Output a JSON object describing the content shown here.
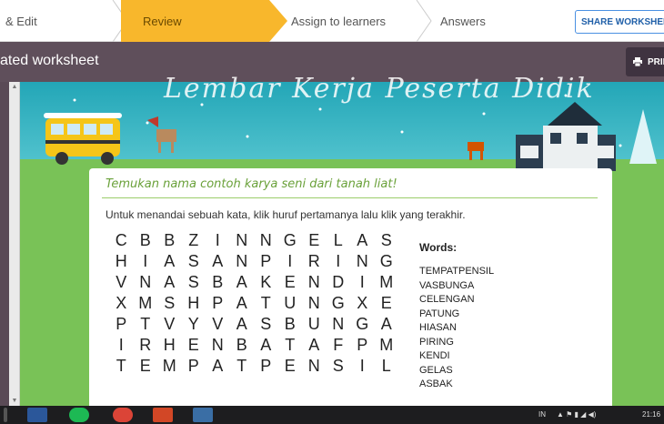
{
  "stepper": {
    "steps": [
      "& Edit",
      "Review",
      "Assign to learners",
      "Answers"
    ],
    "share_label": "SHARE WORKSHEET"
  },
  "titlebar": {
    "title": "ated worksheet",
    "print_label": "PRIN"
  },
  "worksheet": {
    "banner_title": "Lembar Kerja Peserta Didik",
    "instruction_title": "Temukan nama contoh karya seni dari tanah liat!",
    "hint": "Untuk menandai sebuah kata, klik huruf pertamanya lalu klik yang terakhir.",
    "grid": [
      [
        "C",
        "B",
        "B",
        "Z",
        "I",
        "N",
        "N",
        "G",
        "E",
        "L",
        "A",
        "S"
      ],
      [
        "H",
        "I",
        "A",
        "S",
        "A",
        "N",
        "P",
        "I",
        "R",
        "I",
        "N",
        "G"
      ],
      [
        "V",
        "N",
        "A",
        "S",
        "B",
        "A",
        "K",
        "E",
        "N",
        "D",
        "I",
        "M"
      ],
      [
        "X",
        "M",
        "S",
        "H",
        "P",
        "A",
        "T",
        "U",
        "N",
        "G",
        "X",
        "E"
      ],
      [
        "P",
        "T",
        "V",
        "Y",
        "V",
        "A",
        "S",
        "B",
        "U",
        "N",
        "G",
        "A"
      ],
      [
        "I",
        "R",
        "H",
        "E",
        "N",
        "B",
        "A",
        "T",
        "A",
        "F",
        "P",
        "M"
      ],
      [
        "T",
        "E",
        "M",
        "P",
        "A",
        "T",
        "P",
        "E",
        "N",
        "S",
        "I",
        "L"
      ]
    ],
    "words_label": "Words:",
    "words": [
      "TEMPATPENSIL",
      "VASBUNGA",
      "CELENGAN",
      "PATUNG",
      "HIASAN",
      "PIRING",
      "KENDI",
      "GELAS",
      "ASBAK"
    ]
  },
  "taskbar": {
    "lang": "IN",
    "clock": "21:16"
  },
  "colors": {
    "review_step": "#f8b72c",
    "titlebar": "#5f4f5b",
    "grass": "#79c257",
    "instruction_green": "#6aa13a"
  }
}
